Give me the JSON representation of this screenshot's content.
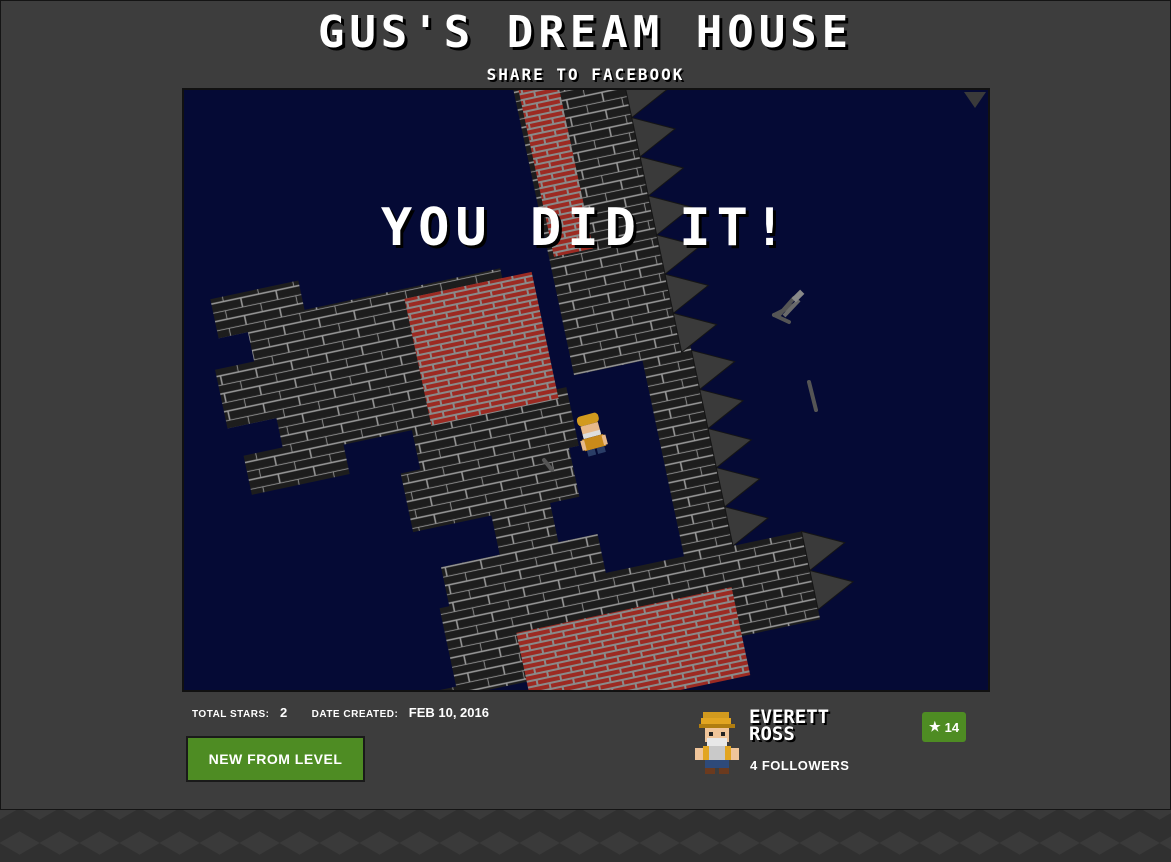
{
  "level": {
    "title": "GUS'S DREAM HOUSE",
    "share_label": "SHARE TO FACEBOOK",
    "banner_text": "YOU DID IT!"
  },
  "stats": {
    "total_stars_label": "TOTAL STARS:",
    "total_stars_value": "2",
    "date_created_label": "DATE CREATED:",
    "date_created_value": "FEB 10, 2016"
  },
  "actions": {
    "new_from_level_label": "NEW FROM LEVEL"
  },
  "author": {
    "name_line1": "EVERETT",
    "name_line2": "ROSS",
    "followers": "4 FOLLOWERS",
    "star_badge_icon": "star-icon",
    "star_count": "14"
  },
  "colors": {
    "accent_green": "#4e8c23",
    "game_background": "#050a35",
    "panel": "#3d3d3d"
  }
}
